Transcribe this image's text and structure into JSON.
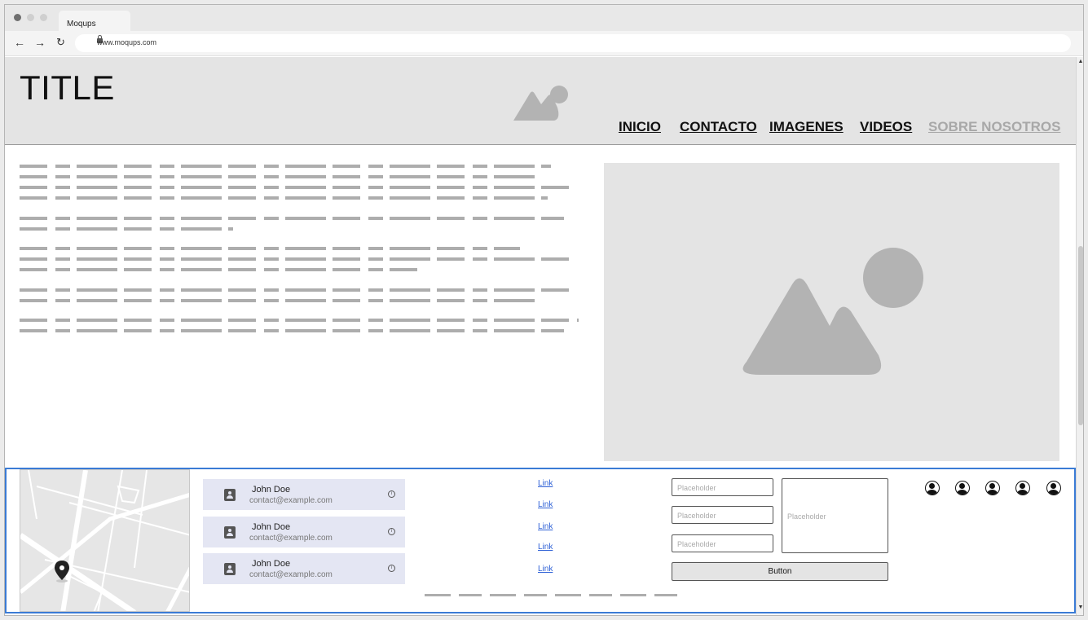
{
  "browser": {
    "tab_title": "Moqups",
    "url": "www.moqups.com",
    "dot_colors": [
      "#6f6f6f",
      "#cfcfcf",
      "#cfcfcf"
    ]
  },
  "header": {
    "title": "TITLE",
    "nav": [
      "INICIO",
      "CONTACTO",
      "IMAGENES",
      "VIDEOS",
      "SOBRE NOSOTROS"
    ]
  },
  "contacts": [
    {
      "name": "John Doe",
      "email": "contact@example.com"
    },
    {
      "name": "John Doe",
      "email": "contact@example.com"
    },
    {
      "name": "John Doe",
      "email": "contact@example.com"
    }
  ],
  "links": [
    "Link",
    "Link",
    "Link",
    "Link",
    "Link"
  ],
  "form": {
    "input_placeholders": [
      "Placeholder",
      "Placeholder",
      "Placeholder"
    ],
    "textarea_placeholder": "Placeholder",
    "button_label": "Button"
  },
  "colors": {
    "footer_border": "#3a7bd5",
    "link": "#2f61d6",
    "nav_muted": "#a8a8a8"
  }
}
